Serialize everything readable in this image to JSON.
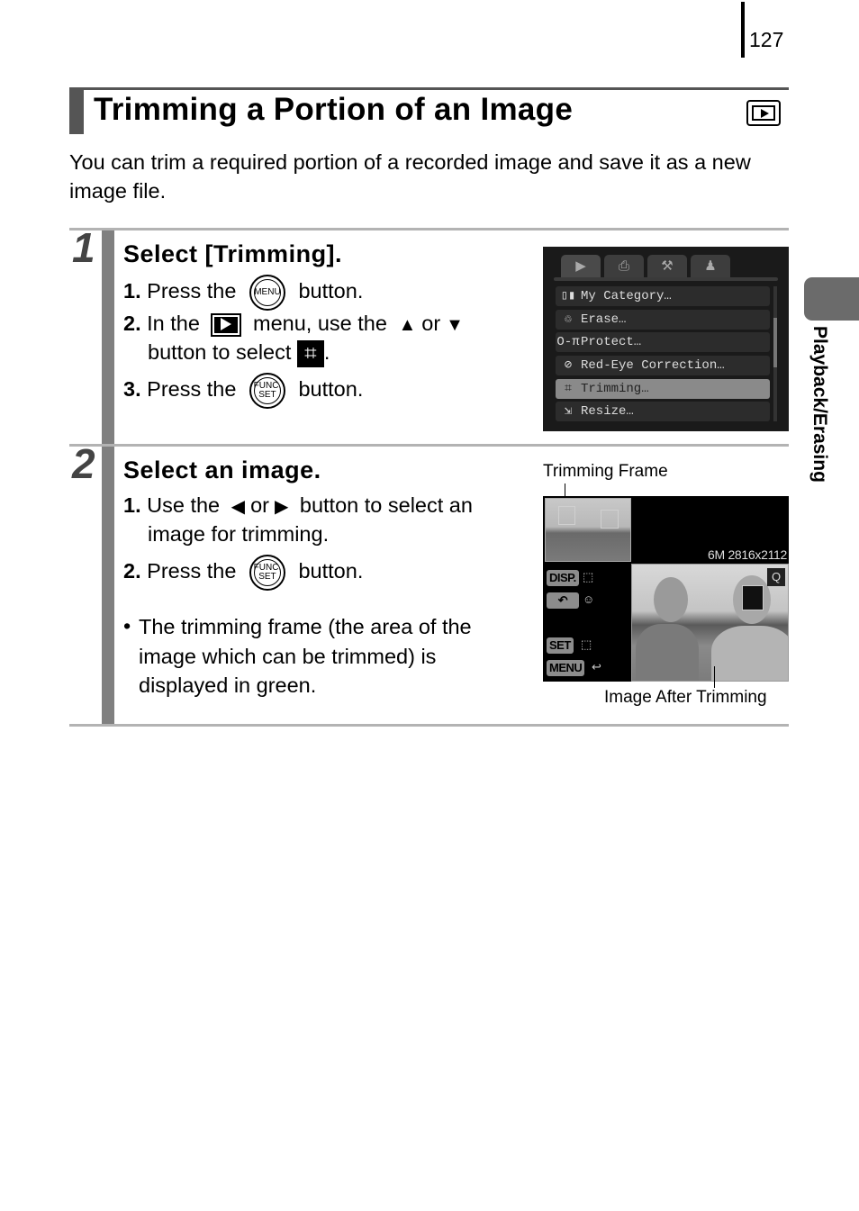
{
  "page": {
    "number": "127",
    "section_tab": "Playback/Erasing"
  },
  "heading": {
    "title": "Trimming a Portion of an Image",
    "mode_icon": "playback-mode-icon"
  },
  "intro": "You can trim a required portion of a recorded image and save it as a new image file.",
  "steps": [
    {
      "number": "1",
      "title": "Select [Trimming].",
      "items": [
        {
          "num": "1.",
          "pre": "Press the",
          "icon": "MENU",
          "post": "button."
        },
        {
          "num": "2.",
          "pre": "In the",
          "mid1": "menu, use the",
          "arrow1": "▲",
          "or": "or",
          "arrow2": "▼",
          "line2_pre": "button to select",
          "line2_post": "."
        },
        {
          "num": "3.",
          "pre": "Press the",
          "icon_l1": "FUNC.",
          "icon_l2": "SET",
          "post": "button."
        }
      ],
      "screen": {
        "tabs": [
          "playback-tab",
          "print-tab",
          "setup-tab",
          "my-camera-tab"
        ],
        "menu_items": [
          {
            "icon": "▯▮",
            "label": "My Category…",
            "selected": false
          },
          {
            "icon": "♲",
            "label": "Erase…",
            "selected": false
          },
          {
            "icon": "O‑π",
            "label": "Protect…",
            "selected": false
          },
          {
            "icon": "⊘",
            "label": "Red-Eye Correction…",
            "selected": false
          },
          {
            "icon": "⌗",
            "label": "Trimming…",
            "selected": true
          },
          {
            "icon": "⇲",
            "label": "Resize…",
            "selected": false
          }
        ]
      }
    },
    {
      "number": "2",
      "title": "Select an image.",
      "items": [
        {
          "num": "1.",
          "pre": "Use the",
          "arrow1": "◀",
          "or": "or",
          "arrow2": "▶",
          "post": "button to select an",
          "line2": "image for trimming."
        },
        {
          "num": "2.",
          "pre": "Press the",
          "icon_l1": "FUNC.",
          "icon_l2": "SET",
          "post": "button."
        }
      ],
      "bullet": "The trimming frame (the area of the image which can be trimmed) is displayed in green.",
      "bullet_lines": [
        "The trimming frame (the area of the",
        "image which can be trimmed) is",
        "displayed in green."
      ],
      "screen": {
        "caption_frame": "Trimming Frame",
        "caption_after": "Image After Trimming",
        "resolution": "6M  2816x2112",
        "controls": [
          {
            "label": "DISP.",
            "icon": "⬚"
          },
          {
            "label": "↶",
            "icon": "☺"
          },
          {
            "label": "SET",
            "icon": "⬚"
          },
          {
            "label": "MENU",
            "icon": "↩"
          }
        ],
        "zoom_icon": "Q"
      }
    }
  ]
}
